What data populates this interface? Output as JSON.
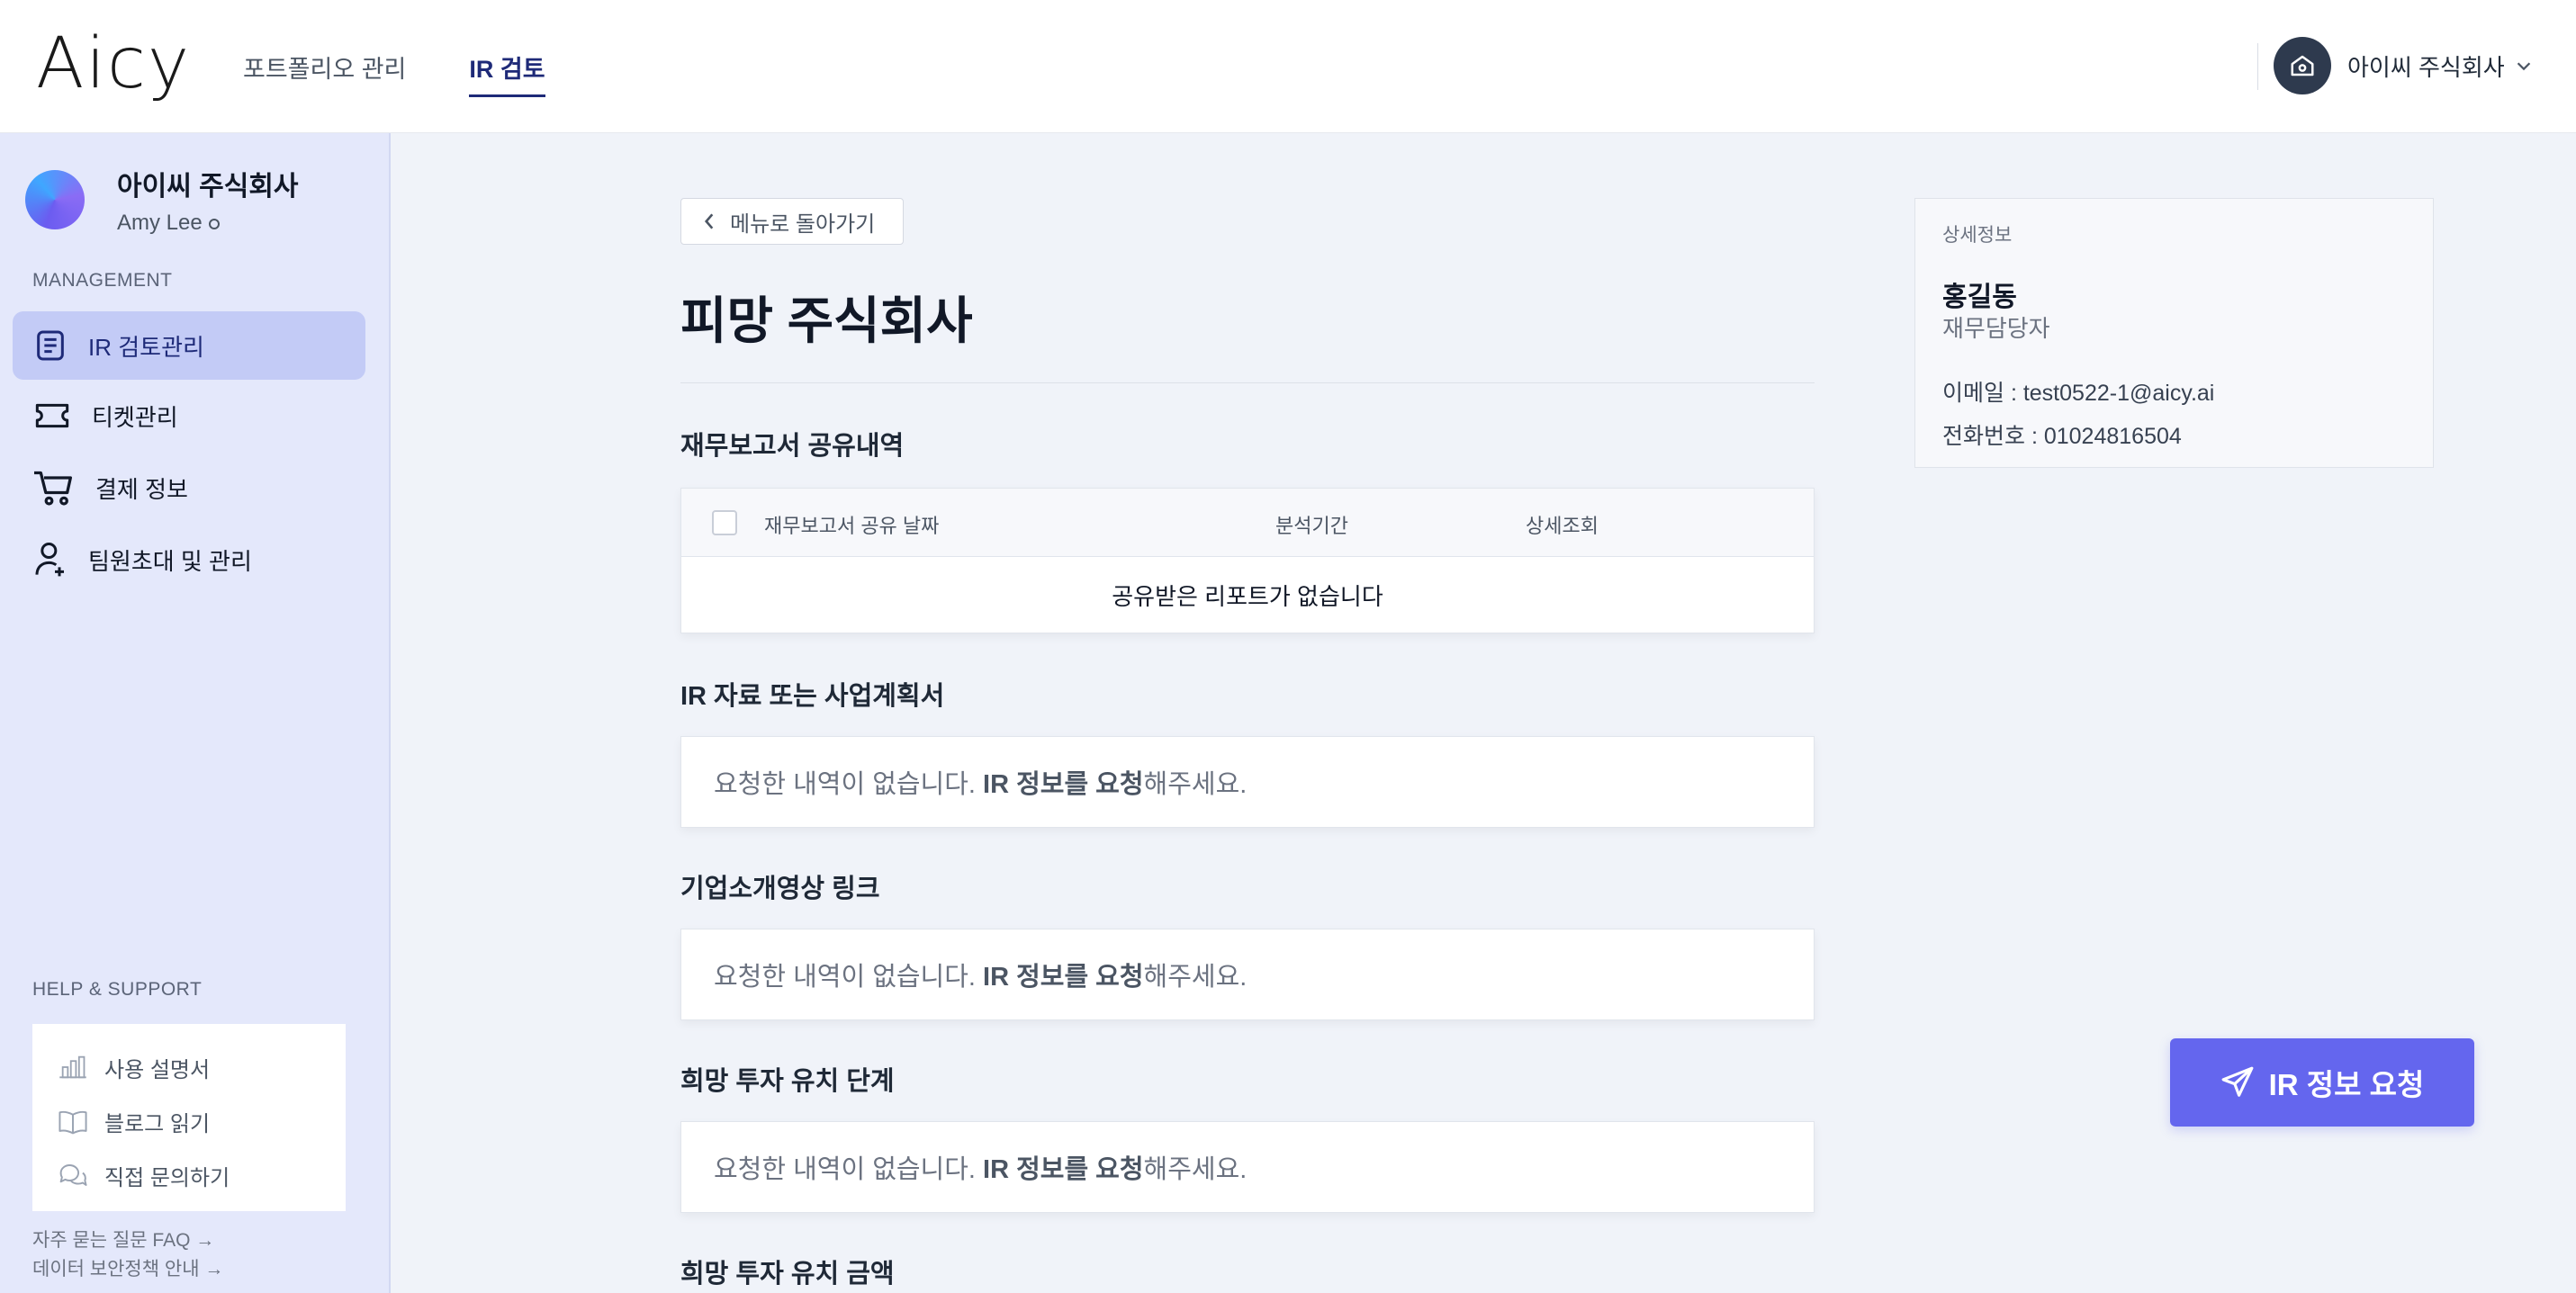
{
  "header": {
    "logo": "Aicy",
    "tabs": [
      {
        "label": "포트폴리오 관리",
        "active": false
      },
      {
        "label": "IR 검토",
        "active": true
      }
    ],
    "account_name": "아이씨 주식회사"
  },
  "sidebar": {
    "company": "아이씨 주식회사",
    "user": "Amy Lee",
    "management_label": "MANAGEMENT",
    "items": [
      {
        "label": "IR 검토관리",
        "icon": "document-icon",
        "active": true
      },
      {
        "label": "티켓관리",
        "icon": "ticket-icon",
        "active": false
      },
      {
        "label": "결제 정보",
        "icon": "cart-icon",
        "active": false
      },
      {
        "label": "팀원초대 및 관리",
        "icon": "user-add-icon",
        "active": false
      }
    ],
    "help_label": "HELP & SUPPORT",
    "help_items": [
      {
        "label": "사용 설명서",
        "icon": "chart-icon"
      },
      {
        "label": "블로그 읽기",
        "icon": "book-icon"
      },
      {
        "label": "직접 문의하기",
        "icon": "chat-icon"
      }
    ],
    "footer_links": [
      "자주 묻는 질문 FAQ →",
      "데이터 보안정책 안내 →"
    ]
  },
  "main": {
    "back_label": "메뉴로 돌아가기",
    "title": "피망 주식회사",
    "reports_section": {
      "title": "재무보고서 공유내역",
      "columns": [
        "재무보고서 공유 날짜",
        "분석기간",
        "상세조회"
      ],
      "empty_text": "공유받은 리포트가 없습니다"
    },
    "empty_prefix": "요청한 내역이 없습니다. ",
    "empty_link": "IR 정보를 요청",
    "empty_suffix": "해주세요.",
    "sections": [
      "IR 자료 또는 사업계획서",
      "기업소개영상 링크",
      "희망 투자 유치 단계",
      "희망 투자 유치 금액"
    ]
  },
  "detail": {
    "caption": "상세정보",
    "name": "홍길동",
    "role": "재무담당자",
    "email_line": "이메일 : test0522-1@aicy.ai",
    "phone_line": "전화번호 : 01024816504"
  },
  "request_button": "IR 정보 요청",
  "colors": {
    "accent": "#6466ee",
    "active_nav": "#1e2a78",
    "sidebar_bg": "#e4e8fb"
  }
}
